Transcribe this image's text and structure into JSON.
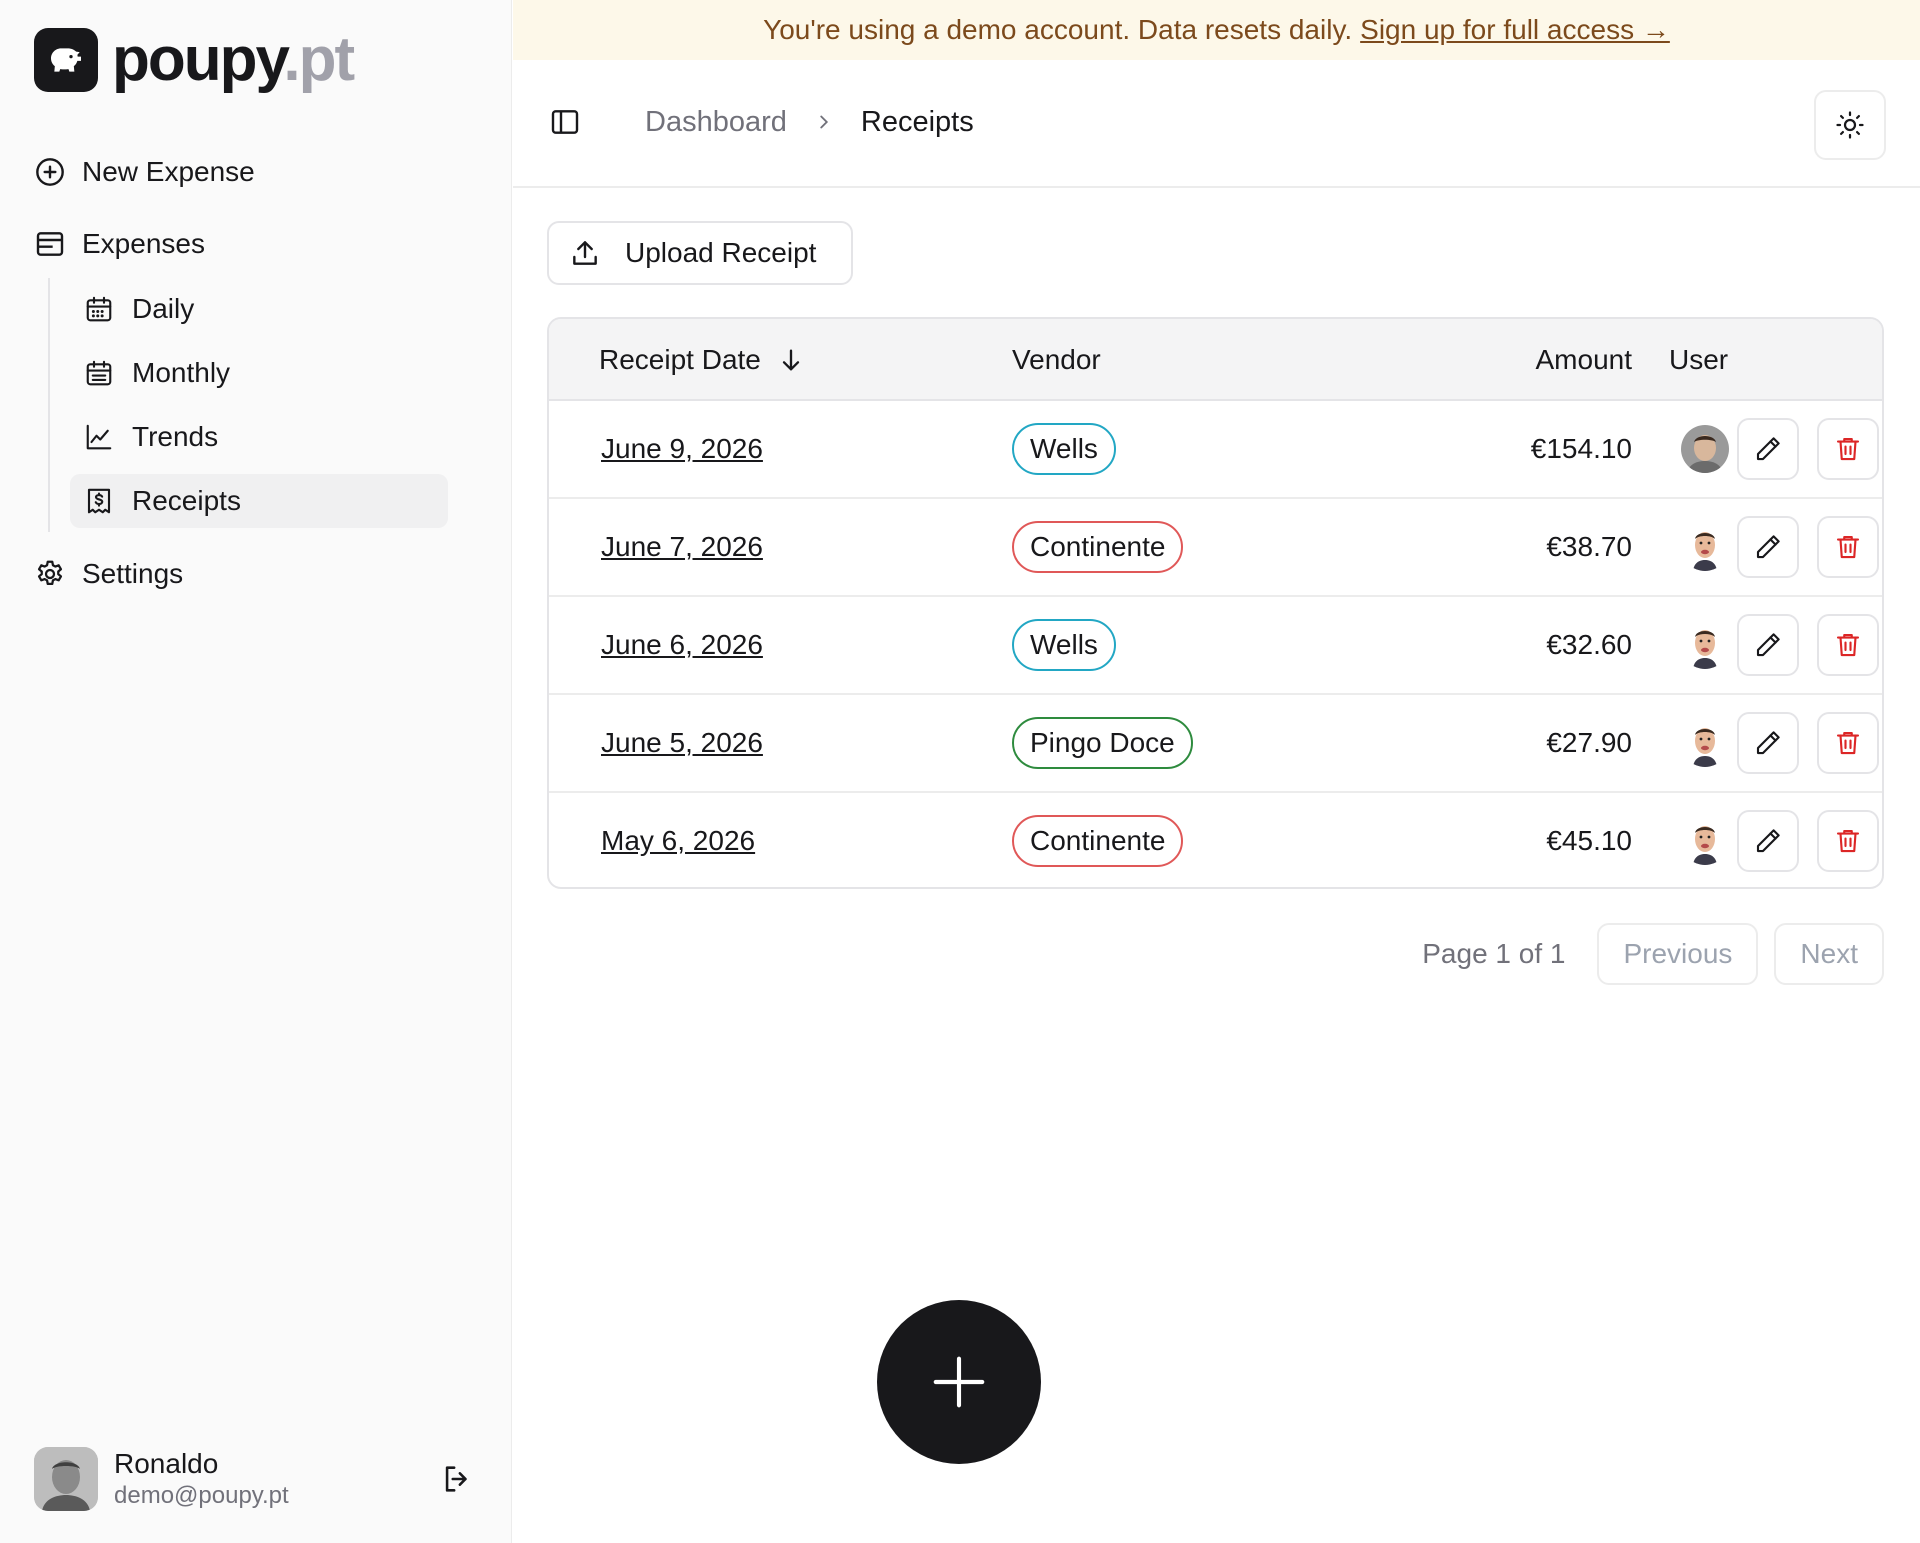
{
  "brand": {
    "name": "poupy",
    "tld": ".pt"
  },
  "sidebar": {
    "new_expense": "New Expense",
    "expenses": "Expenses",
    "sub_items": [
      {
        "label": "Daily",
        "icon": "calendar-grid-icon"
      },
      {
        "label": "Monthly",
        "icon": "calendar-list-icon"
      },
      {
        "label": "Trends",
        "icon": "line-chart-icon"
      },
      {
        "label": "Receipts",
        "icon": "receipt-icon",
        "active": true
      }
    ],
    "settings": "Settings",
    "user": {
      "name": "Ronaldo",
      "email": "demo@poupy.pt"
    }
  },
  "banner": {
    "text": "You're using a demo account. Data resets daily.",
    "link": "Sign up for full access →"
  },
  "header": {
    "breadcrumb": [
      "Dashboard",
      "Receipts"
    ]
  },
  "toolbar": {
    "upload_label": "Upload Receipt"
  },
  "table": {
    "columns": [
      "Receipt Date",
      "Vendor",
      "Amount",
      "User"
    ],
    "sort": {
      "column": "Receipt Date",
      "direction": "descending"
    },
    "rows": [
      {
        "date": "June 9, 2026",
        "vendor": "Wells",
        "vendor_color": "#22a7c4",
        "amount": "€154.10",
        "user": "ronaldo"
      },
      {
        "date": "June 7, 2026",
        "vendor": "Continente",
        "vendor_color": "#e05858",
        "amount": "€38.70",
        "user": "mr-bean"
      },
      {
        "date": "June 6, 2026",
        "vendor": "Wells",
        "vendor_color": "#22a7c4",
        "amount": "€32.60",
        "user": "mr-bean"
      },
      {
        "date": "June 5, 2026",
        "vendor": "Pingo Doce",
        "vendor_color": "#2e8b3e",
        "amount": "€27.90",
        "user": "mr-bean"
      },
      {
        "date": "May 6, 2026",
        "vendor": "Continente",
        "vendor_color": "#e05858",
        "amount": "€45.10",
        "user": "mr-bean"
      }
    ]
  },
  "pagination": {
    "info": "Page 1 of 1",
    "previous": "Previous",
    "next": "Next"
  },
  "colors": {
    "accent": "#18181b",
    "delete": "#dc2626",
    "banner_bg": "#fdf8e9",
    "banner_text": "#7c4a1c"
  }
}
